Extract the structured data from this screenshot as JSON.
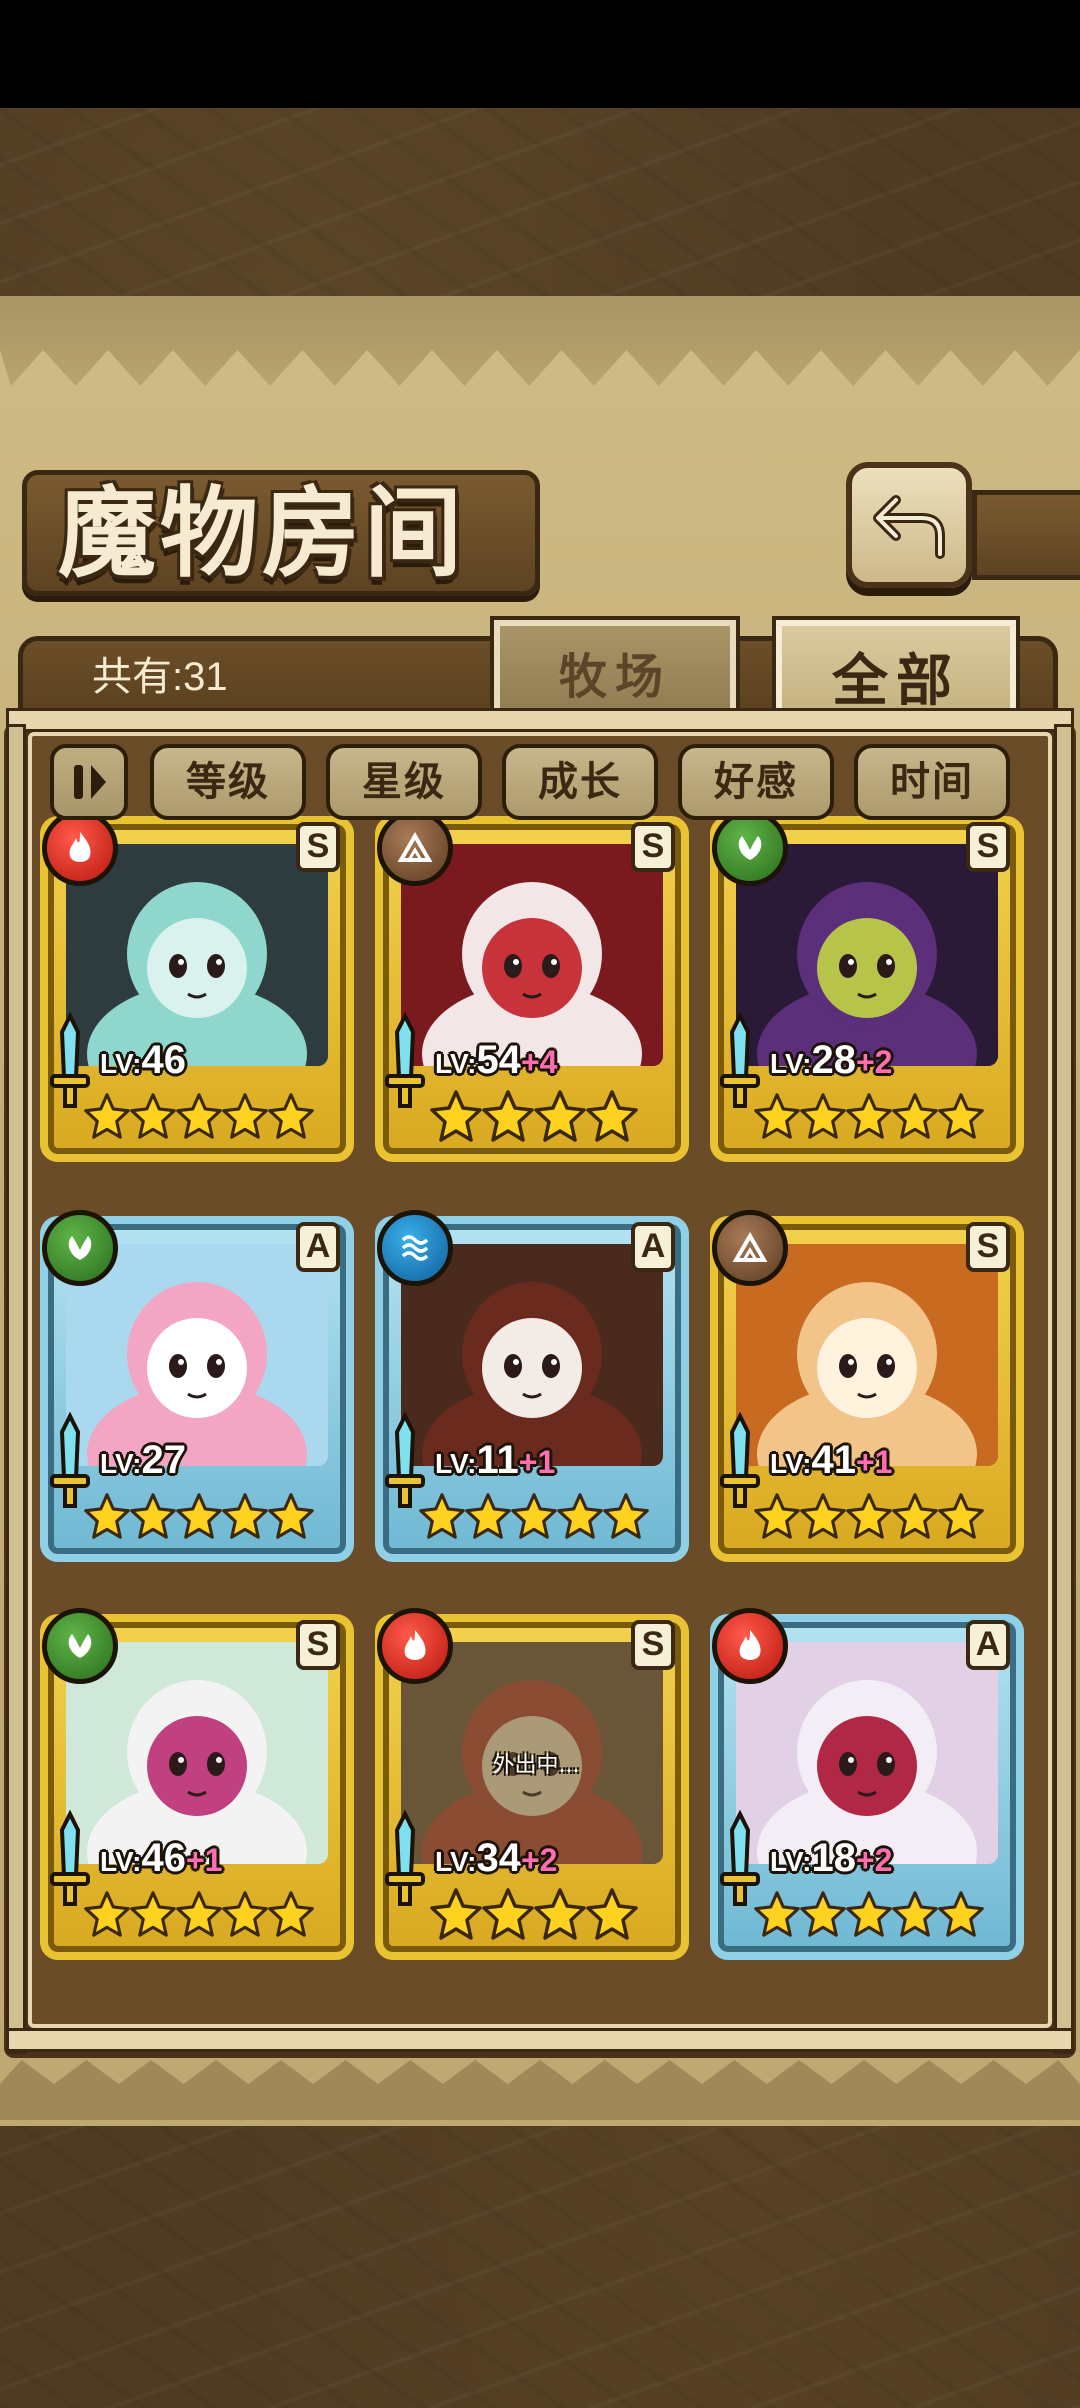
{
  "screen": {
    "title": "魔物房间",
    "count_label": "共有:31",
    "back_button_icon": "return-arrow-icon"
  },
  "tabs": [
    {
      "label": "牧场",
      "active": false
    },
    {
      "label": "全部",
      "active": true
    }
  ],
  "sort_bar": {
    "toggle_icon": "pause-sort-icon",
    "options": [
      "等级",
      "星级",
      "成长",
      "好感",
      "时间"
    ]
  },
  "monsters": [
    {
      "element": "fire",
      "rank": "S",
      "frame": "gold",
      "level_prefix": "LV:",
      "level": "46",
      "bonus": "",
      "stars": 5,
      "status": ""
    },
    {
      "element": "earth",
      "rank": "S",
      "frame": "gold",
      "level_prefix": "LV:",
      "level": "54",
      "bonus": "+4",
      "stars": 4,
      "status": ""
    },
    {
      "element": "wood",
      "rank": "S",
      "frame": "gold",
      "level_prefix": "LV:",
      "level": "28",
      "bonus": "+2",
      "stars": 5,
      "status": ""
    },
    {
      "element": "wood",
      "rank": "A",
      "frame": "blue",
      "level_prefix": "LV:",
      "level": "27",
      "bonus": "",
      "stars": 5,
      "status": ""
    },
    {
      "element": "water",
      "rank": "A",
      "frame": "blue",
      "level_prefix": "LV:",
      "level": "11",
      "bonus": "+1",
      "stars": 5,
      "status": ""
    },
    {
      "element": "earth",
      "rank": "S",
      "frame": "gold",
      "level_prefix": "LV:",
      "level": "41",
      "bonus": "+1",
      "stars": 5,
      "status": ""
    },
    {
      "element": "wood",
      "rank": "S",
      "frame": "gold",
      "level_prefix": "LV:",
      "level": "46",
      "bonus": "+1",
      "stars": 5,
      "status": ""
    },
    {
      "element": "fire",
      "rank": "S",
      "frame": "gold",
      "level_prefix": "LV:",
      "level": "34",
      "bonus": "+2",
      "stars": 4,
      "status": "外出中..."
    },
    {
      "element": "fire",
      "rank": "A",
      "frame": "blue",
      "level_prefix": "LV:",
      "level": "18",
      "bonus": "+2",
      "stars": 5,
      "status": ""
    }
  ],
  "colors": {
    "gold_frame": "#e9c332",
    "blue_frame": "#8fd0e6",
    "bonus_text": "#ff6fb0",
    "fire": "#d8261a",
    "earth": "#7a5335",
    "wood": "#3d8a2c",
    "water": "#1a7fc4"
  }
}
